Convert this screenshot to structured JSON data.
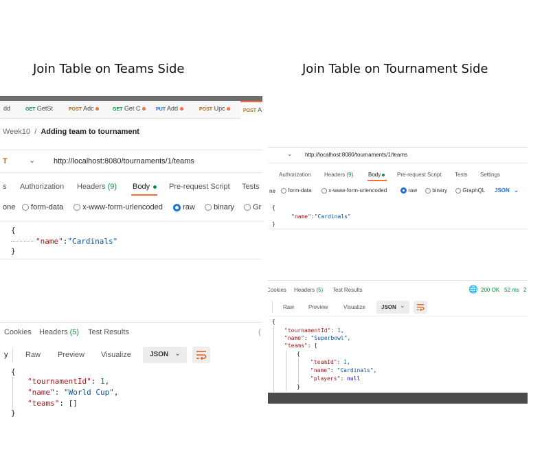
{
  "headings": {
    "left": "Join Table on Teams Side",
    "right": "Join Table on Tournament Side"
  },
  "left": {
    "tabs": [
      {
        "method": "",
        "name": "dd"
      },
      {
        "method": "GET",
        "name": "GetSt"
      },
      {
        "method": "POST",
        "name": "Adc"
      },
      {
        "method": "GET",
        "name": "Get C"
      },
      {
        "method": "PUT",
        "name": "Add"
      },
      {
        "method": "POST",
        "name": "Upc"
      },
      {
        "method": "POST",
        "name": "A"
      }
    ],
    "breadcrumb_parent": "Week10",
    "breadcrumb_sep": "/",
    "request_name": "Adding team to tournament",
    "method_tail": "T",
    "url": "http://localhost:8080/tournaments/1/teams",
    "request_tabs": {
      "params_tail": "s",
      "authorization": "Authorization",
      "headers": "Headers",
      "headers_count": "(9)",
      "body": "Body",
      "prerequest": "Pre-request Script",
      "tests": "Tests"
    },
    "body_options": {
      "none_tail": "one",
      "form_data": "form-data",
      "urlencoded": "x-www-form-urlencoded",
      "raw": "raw",
      "binary": "binary",
      "graphql_tail": "Gr"
    },
    "request_body": {
      "open": "{",
      "key": "\"name\"",
      "colon": ":",
      "value": "\"Cardinals\"",
      "close": "}"
    },
    "response_tabs": {
      "cookies": "Cookies",
      "headers": "Headers",
      "headers_count": "(5)",
      "test_results": "Test Results",
      "edge": "("
    },
    "response_toolbar": {
      "pretty_tail": "y",
      "raw": "Raw",
      "preview": "Preview",
      "visualize": "Visualize",
      "format": "JSON",
      "wrap_icon": "wrap-lines-icon"
    },
    "response_body": {
      "open": "{",
      "k1": "\"tournamentId\"",
      "v1": "1",
      "k2": "\"name\"",
      "v2": "\"World Cup\"",
      "k3": "\"teams\"",
      "v3": "[]",
      "close": "}"
    }
  },
  "right": {
    "method_tail": "",
    "url": "http://localhost:8080/tournaments/1/teams",
    "request_tabs": {
      "authorization": "Authorization",
      "headers": "Headers",
      "headers_count": "(9)",
      "body": "Body",
      "prerequest": "Pre-request Script",
      "tests": "Tests",
      "settings": "Settings"
    },
    "body_options": {
      "none_tail": "ne",
      "form_data": "form-data",
      "urlencoded": "x-www-form-urlencoded",
      "raw": "raw",
      "binary": "binary",
      "graphql": "GraphQL",
      "format": "JSON"
    },
    "request_body": {
      "open": "{",
      "key": "\"name\"",
      "colon": ":",
      "value": "\"Cardinals\"",
      "close": "}"
    },
    "response_tabs": {
      "cookies": "Cookies",
      "headers": "Headers",
      "headers_count": "(5)",
      "test_results": "Test Results",
      "status": "200 OK",
      "time": "52 ms",
      "edge": "2"
    },
    "response_toolbar": {
      "raw": "Raw",
      "preview": "Preview",
      "visualize": "Visualize",
      "format": "JSON"
    },
    "response_body": {
      "open": "{",
      "k1": "\"tournamentId\"",
      "v1": "1",
      "k2": "\"name\"",
      "v2": "\"Superbowl\"",
      "k3": "\"teams\"",
      "v3": "[",
      "inner_open": "{",
      "k4": "\"teamId\"",
      "v4": "1",
      "k5": "\"name\"",
      "v5": "\"Cardinals\"",
      "k6": "\"players\"",
      "v6": "null",
      "inner_close": "}"
    }
  },
  "colors": {
    "accent_green": "#0a8f3c",
    "get_green": "#0a8f3c",
    "post_orange": "#b76800",
    "put_blue": "#1f6fd6",
    "radio_blue": "#1f6fd6",
    "wrap_orange": "#e0611a",
    "dark_bar": "#4a4a4a"
  }
}
